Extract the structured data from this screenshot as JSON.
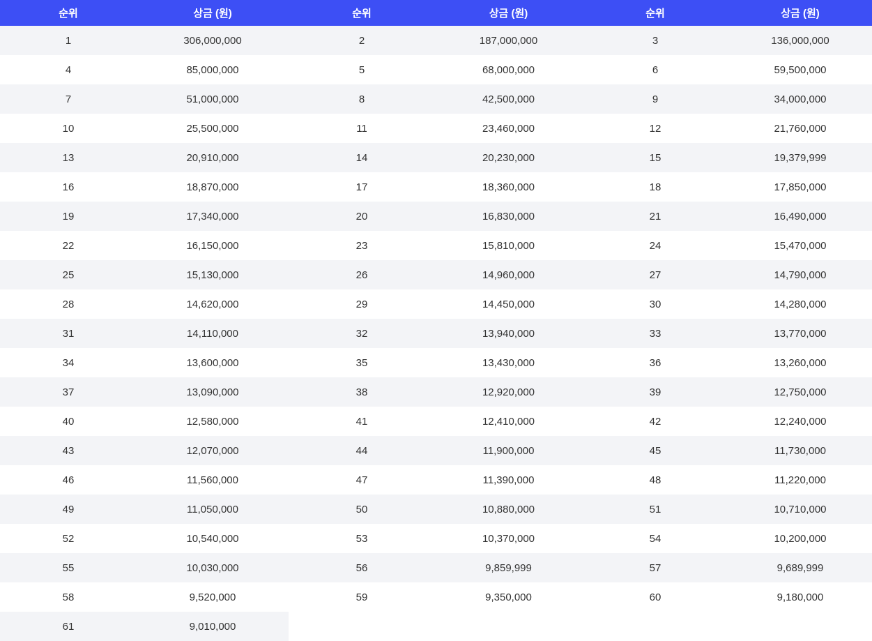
{
  "header": {
    "rank_label": "순위",
    "prize_label": "상금 (원)"
  },
  "rows": [
    [
      {
        "rank": "1",
        "prize": "306,000,000"
      },
      {
        "rank": "2",
        "prize": "187,000,000"
      },
      {
        "rank": "3",
        "prize": "136,000,000"
      }
    ],
    [
      {
        "rank": "4",
        "prize": "85,000,000"
      },
      {
        "rank": "5",
        "prize": "68,000,000"
      },
      {
        "rank": "6",
        "prize": "59,500,000"
      }
    ],
    [
      {
        "rank": "7",
        "prize": "51,000,000"
      },
      {
        "rank": "8",
        "prize": "42,500,000"
      },
      {
        "rank": "9",
        "prize": "34,000,000"
      }
    ],
    [
      {
        "rank": "10",
        "prize": "25,500,000"
      },
      {
        "rank": "11",
        "prize": "23,460,000"
      },
      {
        "rank": "12",
        "prize": "21,760,000"
      }
    ],
    [
      {
        "rank": "13",
        "prize": "20,910,000"
      },
      {
        "rank": "14",
        "prize": "20,230,000"
      },
      {
        "rank": "15",
        "prize": "19,379,999"
      }
    ],
    [
      {
        "rank": "16",
        "prize": "18,870,000"
      },
      {
        "rank": "17",
        "prize": "18,360,000"
      },
      {
        "rank": "18",
        "prize": "17,850,000"
      }
    ],
    [
      {
        "rank": "19",
        "prize": "17,340,000"
      },
      {
        "rank": "20",
        "prize": "16,830,000"
      },
      {
        "rank": "21",
        "prize": "16,490,000"
      }
    ],
    [
      {
        "rank": "22",
        "prize": "16,150,000"
      },
      {
        "rank": "23",
        "prize": "15,810,000"
      },
      {
        "rank": "24",
        "prize": "15,470,000"
      }
    ],
    [
      {
        "rank": "25",
        "prize": "15,130,000"
      },
      {
        "rank": "26",
        "prize": "14,960,000"
      },
      {
        "rank": "27",
        "prize": "14,790,000"
      }
    ],
    [
      {
        "rank": "28",
        "prize": "14,620,000"
      },
      {
        "rank": "29",
        "prize": "14,450,000"
      },
      {
        "rank": "30",
        "prize": "14,280,000"
      }
    ],
    [
      {
        "rank": "31",
        "prize": "14,110,000"
      },
      {
        "rank": "32",
        "prize": "13,940,000"
      },
      {
        "rank": "33",
        "prize": "13,770,000"
      }
    ],
    [
      {
        "rank": "34",
        "prize": "13,600,000"
      },
      {
        "rank": "35",
        "prize": "13,430,000"
      },
      {
        "rank": "36",
        "prize": "13,260,000"
      }
    ],
    [
      {
        "rank": "37",
        "prize": "13,090,000"
      },
      {
        "rank": "38",
        "prize": "12,920,000"
      },
      {
        "rank": "39",
        "prize": "12,750,000"
      }
    ],
    [
      {
        "rank": "40",
        "prize": "12,580,000"
      },
      {
        "rank": "41",
        "prize": "12,410,000"
      },
      {
        "rank": "42",
        "prize": "12,240,000"
      }
    ],
    [
      {
        "rank": "43",
        "prize": "12,070,000"
      },
      {
        "rank": "44",
        "prize": "11,900,000"
      },
      {
        "rank": "45",
        "prize": "11,730,000"
      }
    ],
    [
      {
        "rank": "46",
        "prize": "11,560,000"
      },
      {
        "rank": "47",
        "prize": "11,390,000"
      },
      {
        "rank": "48",
        "prize": "11,220,000"
      }
    ],
    [
      {
        "rank": "49",
        "prize": "11,050,000"
      },
      {
        "rank": "50",
        "prize": "10,880,000"
      },
      {
        "rank": "51",
        "prize": "10,710,000"
      }
    ],
    [
      {
        "rank": "52",
        "prize": "10,540,000"
      },
      {
        "rank": "53",
        "prize": "10,370,000"
      },
      {
        "rank": "54",
        "prize": "10,200,000"
      }
    ],
    [
      {
        "rank": "55",
        "prize": "10,030,000"
      },
      {
        "rank": "56",
        "prize": "9,859,999"
      },
      {
        "rank": "57",
        "prize": "9,689,999"
      }
    ],
    [
      {
        "rank": "58",
        "prize": "9,520,000"
      },
      {
        "rank": "59",
        "prize": "9,350,000"
      },
      {
        "rank": "60",
        "prize": "9,180,000"
      }
    ],
    [
      {
        "rank": "61",
        "prize": "9,010,000"
      }
    ]
  ],
  "colors": {
    "header_bg": "#3d4ff5",
    "stripe_bg": "#f3f4f7",
    "text": "#333333"
  }
}
